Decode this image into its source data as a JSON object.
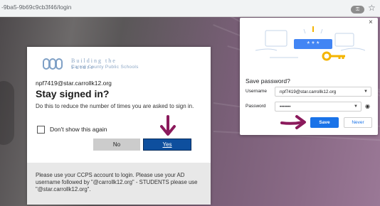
{
  "browser": {
    "url": "-9ba5-9b69c9cb3f46/login",
    "key_icon": "key-icon",
    "star_icon": "star-icon",
    "star_glyph": "☆"
  },
  "signin": {
    "logo_line1": "Building the Future",
    "logo_line2": "Carroll County Public Schools",
    "account": "npf7419@star.carrollk12.org",
    "title": "Stay signed in?",
    "description": "Do this to reduce the number of times you are asked to sign in.",
    "checkbox_label": "Don't show this again",
    "no_label": "No",
    "yes_label": "Yes",
    "footer": "Please use your CCPS account to login. Please use your AD username followed by \"@carrollk12.org\" - STUDENTS please use \"@star.carrollk12.org\"."
  },
  "save_password": {
    "close_glyph": "×",
    "heading": "Save password?",
    "username_label": "Username",
    "username_value": "npf7419@star.carrollk12.org",
    "password_label": "Password",
    "password_value": "•••••••",
    "save_label": "Save",
    "never_label": "Never",
    "illustration_text": "* * *"
  },
  "colors": {
    "accent": "#1a73e8",
    "yes_button": "#0e4f9e",
    "annotation_arrow": "#8b1a5c"
  }
}
